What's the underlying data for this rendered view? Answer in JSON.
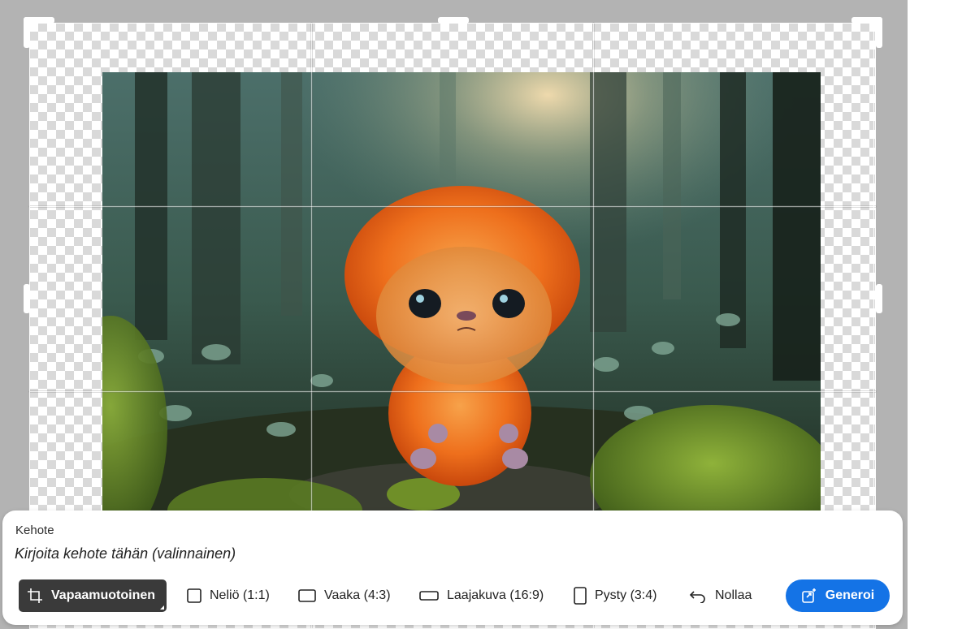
{
  "prompt": {
    "label": "Kehote",
    "placeholder": "Kirjoita kehote tähän (valinnainen)",
    "value": ""
  },
  "aspect_options": [
    {
      "label": "Vapaamuotoinen",
      "icon": "crop-icon",
      "selected": true
    },
    {
      "label": "Neliö (1:1)",
      "icon": "square-icon",
      "selected": false
    },
    {
      "label": "Vaaka (4:3)",
      "icon": "landscape-rect-icon",
      "selected": false
    },
    {
      "label": "Laajakuva (16:9)",
      "icon": "widescreen-rect-icon",
      "selected": false
    },
    {
      "label": "Pysty (3:4)",
      "icon": "portrait-rect-icon",
      "selected": false
    }
  ],
  "reset": {
    "label": "Nollaa",
    "icon": "undo-icon"
  },
  "generate": {
    "label": "Generoi",
    "icon": "generative-expand-icon"
  },
  "colors": {
    "accent": "#1473e6",
    "selected_bg": "#3a3a3a",
    "workspace_bg": "#b3b3b3"
  }
}
